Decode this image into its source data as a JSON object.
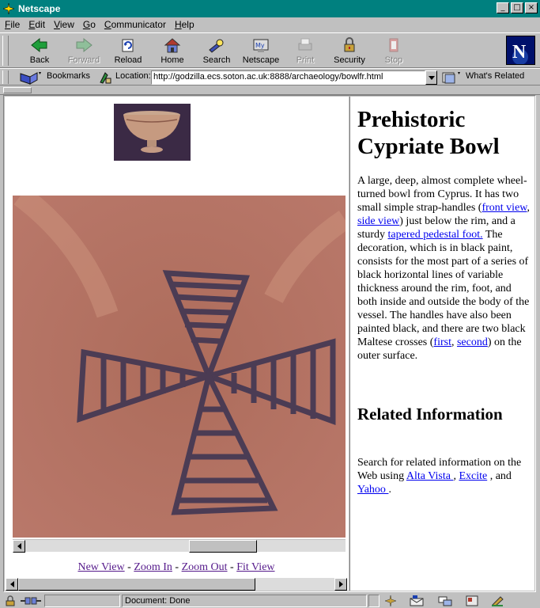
{
  "window": {
    "title": "Netscape",
    "controls": [
      "_",
      "□",
      "×"
    ]
  },
  "menu": [
    {
      "ul": "F",
      "rest": "ile"
    },
    {
      "ul": "E",
      "rest": "dit"
    },
    {
      "ul": "V",
      "rest": "iew"
    },
    {
      "ul": "G",
      "rest": "o"
    },
    {
      "ul": "C",
      "rest": "ommunicator"
    },
    {
      "ul": "H",
      "rest": "elp"
    }
  ],
  "toolbar": {
    "back": "Back",
    "forward": "Forward",
    "reload": "Reload",
    "home": "Home",
    "search": "Search",
    "netscape": "Netscape",
    "print": "Print",
    "security": "Security",
    "stop": "Stop"
  },
  "location": {
    "bookmarks": "Bookmarks",
    "label": "Location:",
    "url": "http://godzilla.ecs.soton.ac.uk:8888/archaeology/bowlfr.html",
    "whats_related": "What's Related"
  },
  "left_frame": {
    "links": {
      "new_view": "New View",
      "zoom_in": "Zoom In",
      "zoom_out": "Zoom Out",
      "fit_view": "Fit View",
      "sep": " - "
    }
  },
  "right_frame": {
    "title": "Prehistoric Cypriate Bowl",
    "body": {
      "t1": "A large, deep, almost complete wheel-turned bowl from Cyprus. It has two small simple strap-handles (",
      "l_front": "front view",
      "t2": ", ",
      "l_side": "side view",
      "t3": ") just below the rim, and a sturdy ",
      "l_foot": "tapered pedestal foot.",
      "t4": " The decoration, which is in black paint, consists for the most part of a series of black horizontal lines of variable thickness around the rim, foot, and both inside and outside the body of the vessel. The handles have also been painted black, and there are two black Maltese crosses (",
      "l_first": "first",
      "t5": ", ",
      "l_second": "second",
      "t6": ") on the outer surface."
    },
    "related_heading": "Related Information",
    "related": {
      "t1": "Search for related information on the Web using ",
      "l_alta": "Alta Vista ",
      "t2": ", ",
      "l_excite": "Excite",
      "t3": " , and ",
      "l_yahoo": "Yahoo ",
      "t4": "."
    }
  },
  "status": {
    "text": "Document: Done"
  },
  "colors": {
    "titlebar": "#00807f",
    "chrome": "#c0c0c0",
    "link": "#0000ee",
    "visited_link": "#551a8b"
  }
}
